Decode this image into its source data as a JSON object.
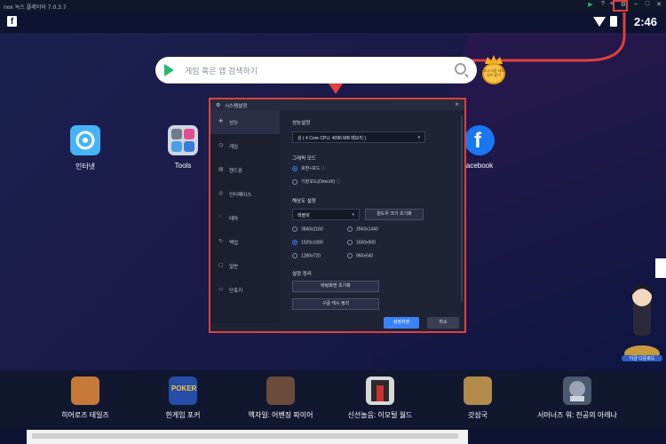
{
  "titlebar": {
    "app_title": "nox 녹스 플레이어 7.0.3.7"
  },
  "statusbar": {
    "time": "2:46"
  },
  "search": {
    "placeholder": "게임 혹은 앱 검색하기"
  },
  "promo": {
    "text": "고시 다음 세트 모드 받기"
  },
  "desktop_apps": [
    {
      "label": "인터넷",
      "color": "#45b4f5"
    },
    {
      "label": "Tools",
      "color": "#cfd6e0"
    },
    {
      "label": "acebook",
      "color": "#1a77f2"
    }
  ],
  "dialog": {
    "title": "시스템설정",
    "sidebar": [
      {
        "label": "성능",
        "icon": "performance-icon"
      },
      {
        "label": "게임",
        "icon": "game-icon"
      },
      {
        "label": "핸드폰",
        "icon": "phone-icon"
      },
      {
        "label": "인터페이스",
        "icon": "interface-icon"
      },
      {
        "label": "테마",
        "icon": "theme-icon"
      },
      {
        "label": "백업",
        "icon": "backup-icon"
      },
      {
        "label": "일반",
        "icon": "general-icon"
      },
      {
        "label": "단축키",
        "icon": "shortcut-icon"
      }
    ],
    "performance": {
      "section": "성능설정",
      "value": "상 ( 4 Core CPU, 4096 MB 메모리 )"
    },
    "graphics": {
      "section": "그래픽 모드",
      "options": [
        "호환+모드",
        "기본모드(DirectX)"
      ],
      "selected": "호환+모드"
    },
    "resolution": {
      "section": "해상도 설정",
      "device": "태블릿",
      "reset_window_button": "윈도우 크기 초기화",
      "options": [
        "3840x2160",
        "2560x1440",
        "1920x1080",
        "1600x900",
        "1280x720",
        "960x540"
      ],
      "selected": "1920x1080"
    },
    "settings_cleanup": {
      "section": "설정 정리",
      "reset_wallpaper_button": "바탕화면 초기화",
      "clear_cache_button": "구글 캐시 정리"
    },
    "save_button": "설정저장",
    "cancel_button": "취소"
  },
  "dock": [
    {
      "label": "히어로즈 테일즈",
      "color": "#c77a38"
    },
    {
      "label": "한게임 포커",
      "color": "#244ea8"
    },
    {
      "label": "엑자일: 어벤징 파이어",
      "color": "#6b4b3a"
    },
    {
      "label": "신선놀음: 이모털 월드",
      "color": "#d8d8d8"
    },
    {
      "label": "갓삼국",
      "color": "#b28a4a"
    },
    {
      "label": "서머너즈 워: 천공의 아레나",
      "color": "#4a5a70"
    }
  ],
  "mascot": {
    "caption": "지금 다운로드"
  }
}
